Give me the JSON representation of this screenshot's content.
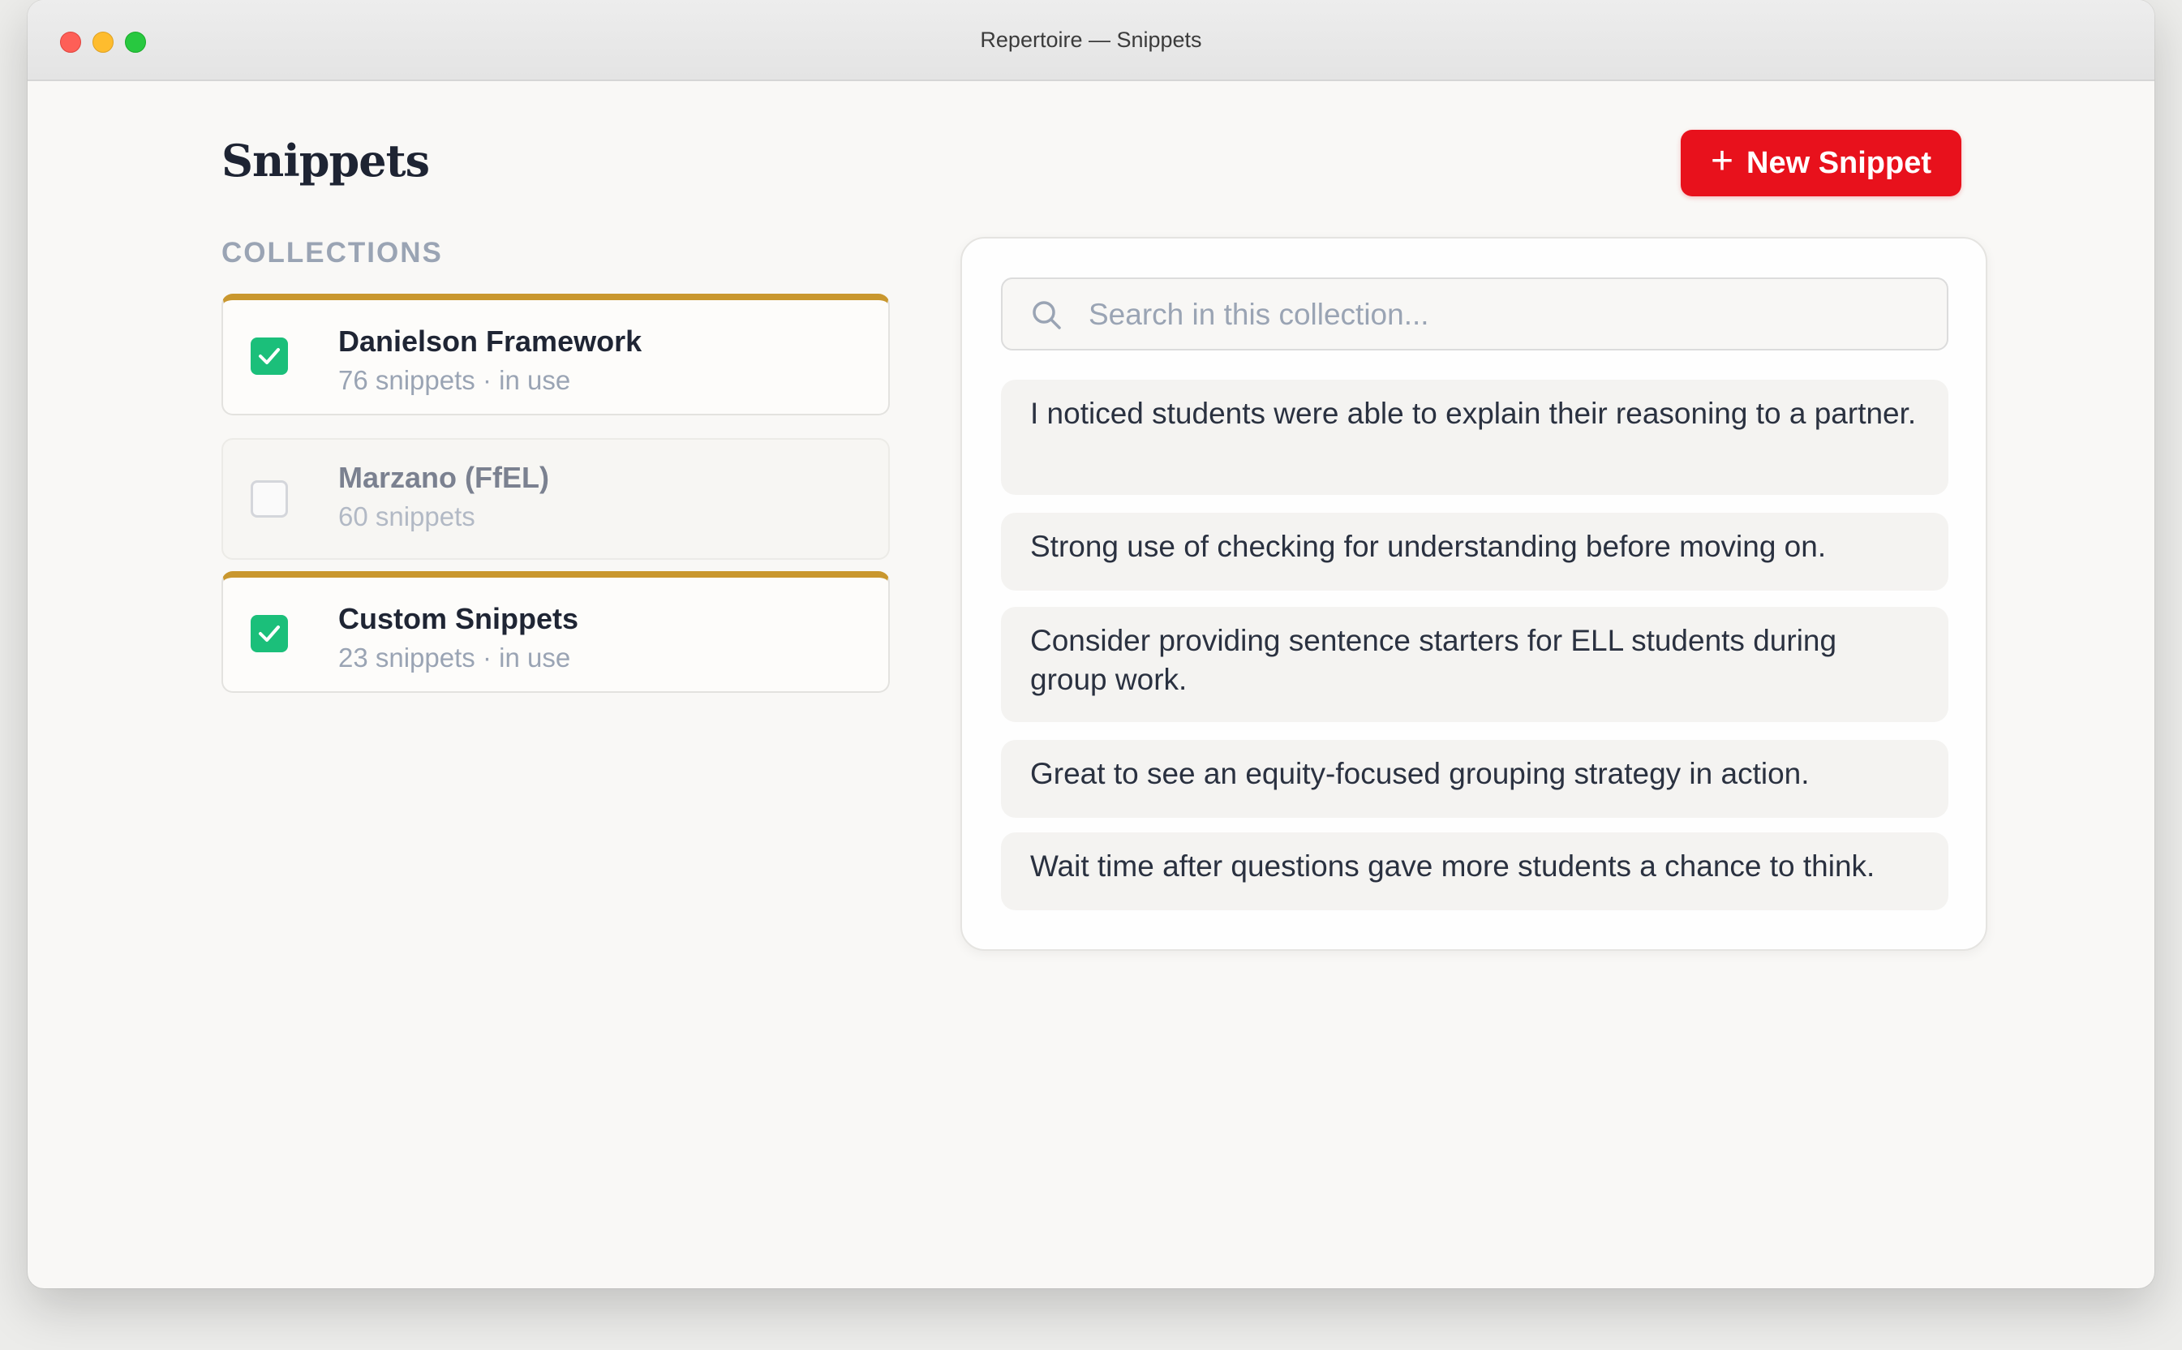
{
  "window": {
    "title": "Repertoire — Snippets"
  },
  "header": {
    "title": "Snippets",
    "new_button_icon": "plus-icon",
    "new_button_label": "New Snippet"
  },
  "colors": {
    "accent": "#e8111c",
    "active_border": "#c9972e",
    "check": "#1bbf7a"
  },
  "collections": {
    "label": "COLLECTIONS",
    "items": [
      {
        "name": "Danielson Framework",
        "meta": "76 snippets · in use",
        "checked": true
      },
      {
        "name": "Marzano (FfEL)",
        "meta": "60 snippets",
        "checked": false
      },
      {
        "name": "Custom Snippets",
        "meta": "23 snippets · in use",
        "checked": true
      }
    ]
  },
  "search": {
    "placeholder": "Search in this collection...",
    "value": ""
  },
  "snippets": [
    "I noticed students were able to explain their reasoning to a partner.",
    "Strong use of checking for understanding before moving on.",
    "Consider providing sentence starters for ELL students during group work.",
    "Great to see an equity-focused grouping strategy in action.",
    "Wait time after questions gave more students a chance to think."
  ]
}
